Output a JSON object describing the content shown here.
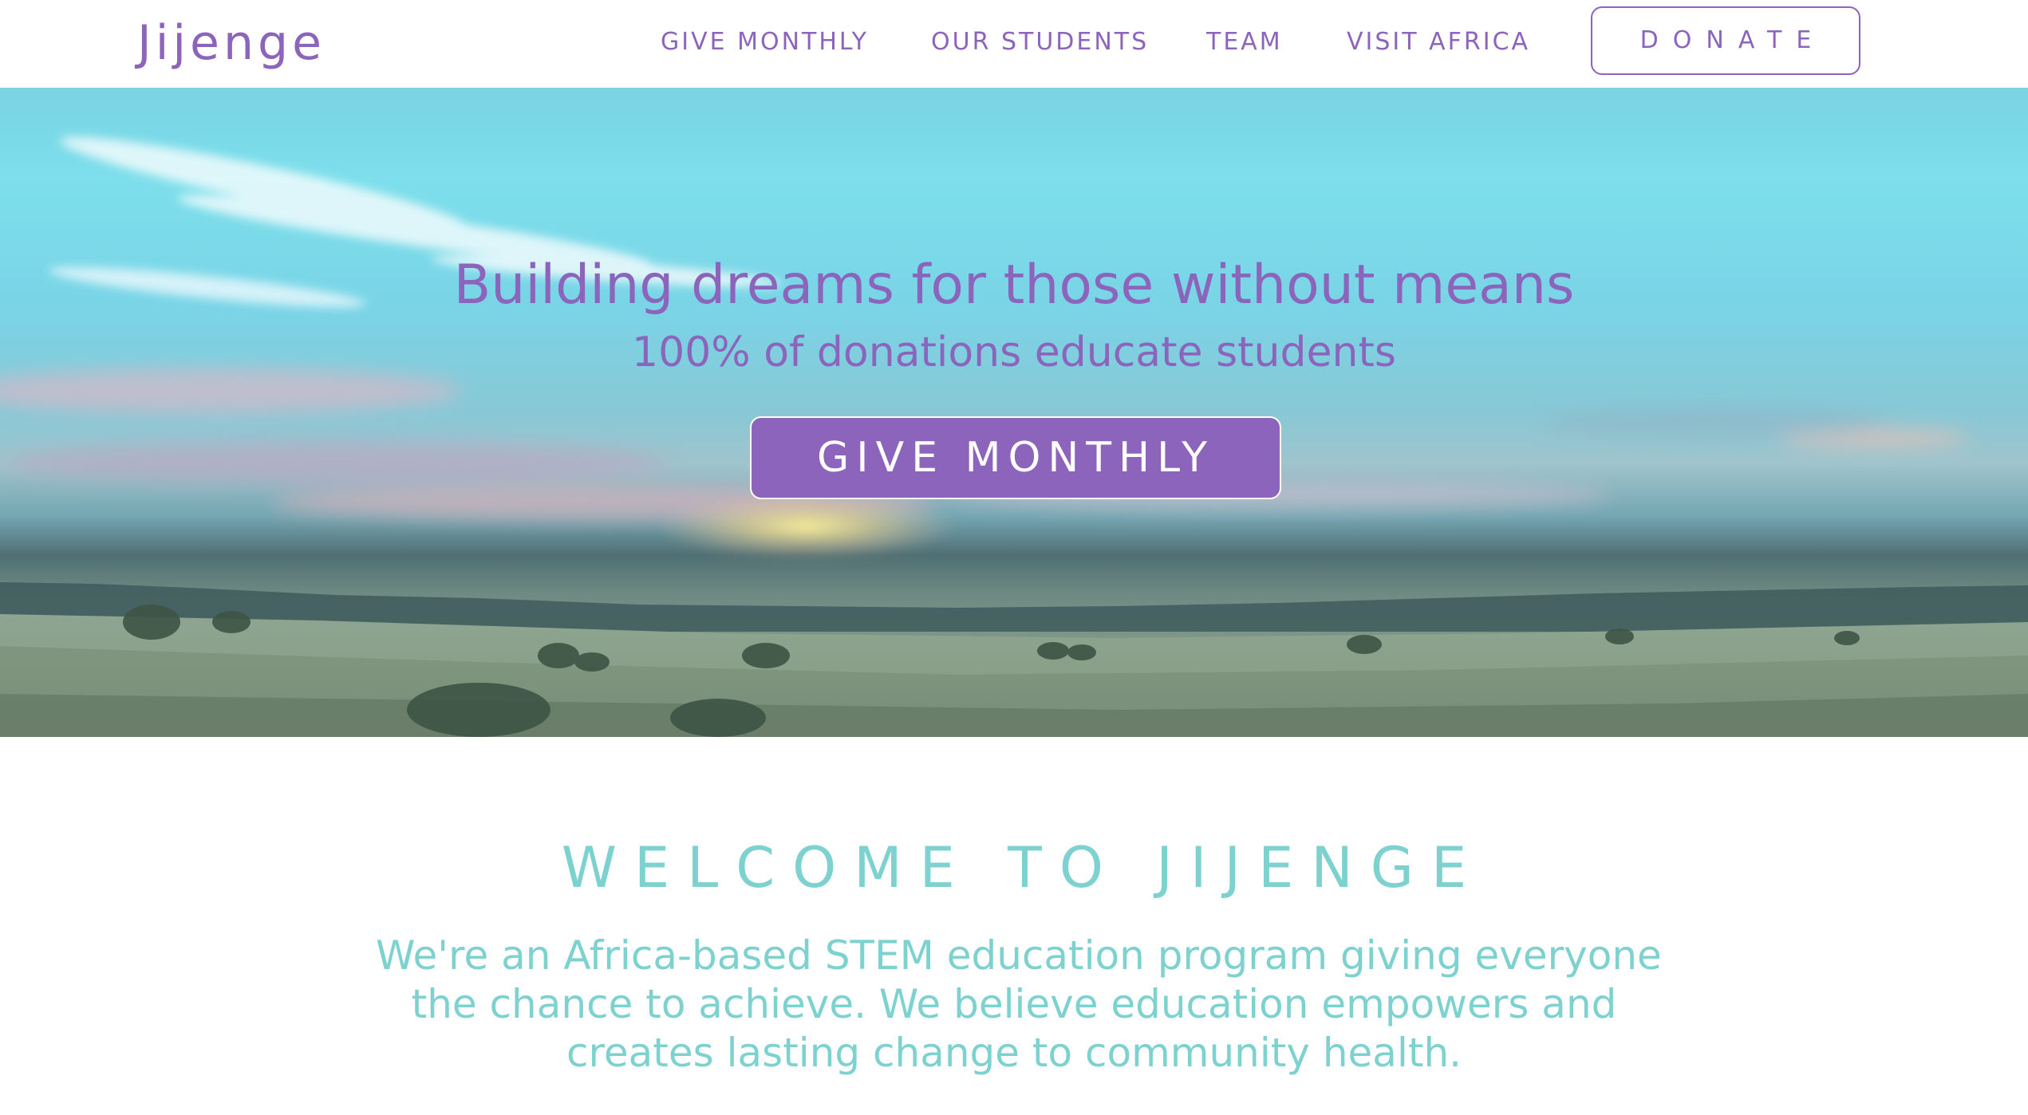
{
  "header": {
    "logo": "Jijenge",
    "nav": {
      "give_monthly": "GIVE MONTHLY",
      "our_students": "OUR STUDENTS",
      "team": "TEAM",
      "visit_africa": "VISIT AFRICA"
    },
    "donate_label": "DONATE"
  },
  "hero": {
    "title": "Building dreams for those without means",
    "subtitle": "100% of donations educate students",
    "cta_label": "GIVE MONTHLY"
  },
  "welcome": {
    "title": "WELCOME TO JIJENGE",
    "lines": [
      "We're an Africa-based STEM education program giving everyone",
      "the chance to achieve. We believe education empowers and",
      "creates lasting change to community health."
    ]
  },
  "colors": {
    "brand_purple": "#8c64bc",
    "accent_teal": "#7dd2d0",
    "white": "#ffffff"
  }
}
